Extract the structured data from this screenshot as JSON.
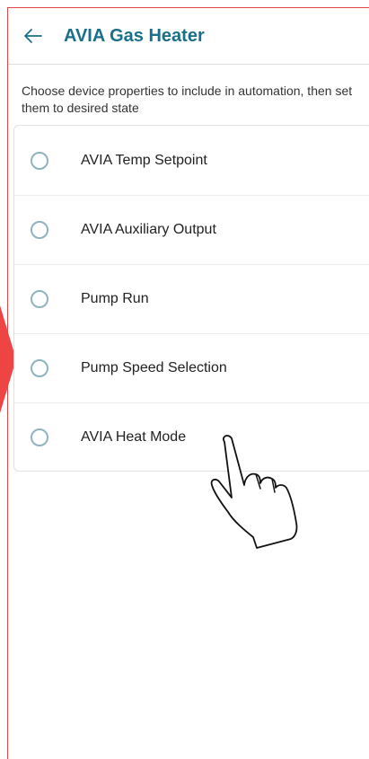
{
  "header": {
    "back_icon": "arrow-left-icon",
    "title": "AVIA Gas Heater"
  },
  "description": "Choose device properties to include in automation, then set them to desired state",
  "properties": [
    {
      "label": "AVIA Temp Setpoint"
    },
    {
      "label": "AVIA Auxiliary Output"
    },
    {
      "label": "Pump Run"
    },
    {
      "label": "Pump Speed Selection"
    },
    {
      "label": "AVIA Heat Mode"
    }
  ],
  "colors": {
    "title": "#1a6f8a",
    "radio_border": "#8fb3bf",
    "frame_border": "#e04848",
    "marker": "#ef4444"
  },
  "overlay": {
    "icon": "pointing-hand-icon"
  }
}
